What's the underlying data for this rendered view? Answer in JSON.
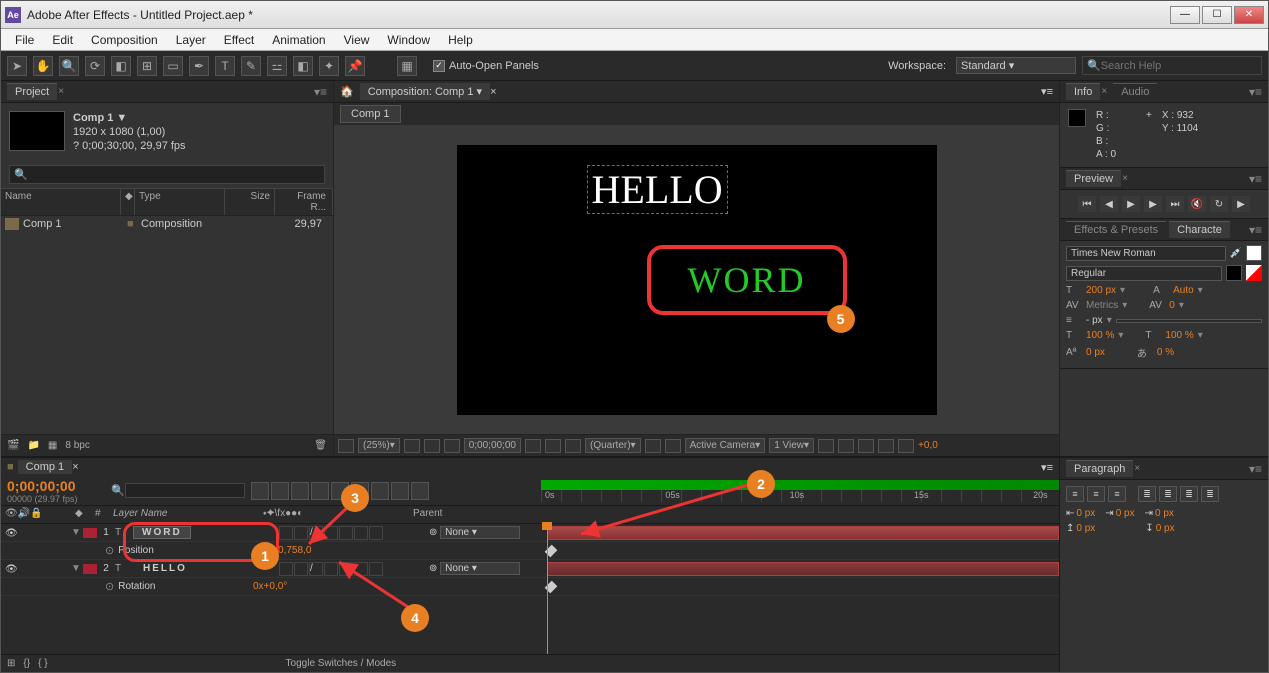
{
  "window": {
    "title": "Adobe After Effects - Untitled Project.aep *"
  },
  "menu": [
    "File",
    "Edit",
    "Composition",
    "Layer",
    "Effect",
    "Animation",
    "View",
    "Window",
    "Help"
  ],
  "toolbar": {
    "auto_open": "Auto-Open Panels",
    "workspace_label": "Workspace:",
    "workspace": "Standard",
    "search_placeholder": "Search Help"
  },
  "project": {
    "panel": "Project",
    "comp_name": "Comp 1 ▼",
    "comp_dims": "1920 x 1080 (1,00)",
    "comp_dur": "? 0;00;30;00, 29,97 fps",
    "cols": {
      "name": "Name",
      "type": "Type",
      "size": "Size",
      "frame": "Frame R..."
    },
    "rows": [
      {
        "name": "Comp 1",
        "type": "Composition",
        "size": "",
        "frame": "29,97"
      }
    ],
    "bpc": "8 bpc"
  },
  "comp_panel": {
    "title": "Composition: Comp 1",
    "tab": "Comp 1",
    "text1": "HELLO",
    "text2": "WORD",
    "footer": {
      "zoom": "(25%)",
      "time": "0;00;00;00",
      "quality": "(Quarter)",
      "camera": "Active Camera",
      "view": "1 View"
    }
  },
  "info": {
    "tab1": "Info",
    "tab2": "Audio",
    "r": "R :",
    "g": "G :",
    "b": "B :",
    "a": "A : 0",
    "x": "X : 932",
    "y": "Y : 1104"
  },
  "preview": {
    "tab": "Preview"
  },
  "effects": {
    "tab1": "Effects & Presets",
    "tab2": "Characte"
  },
  "char": {
    "font": "Times New Roman",
    "style": "Regular",
    "size": "200",
    "size_unit": "px",
    "leading": "Auto",
    "kerning": "Metrics",
    "tracking": "0",
    "stroke": "-",
    "stroke_unit": "px",
    "vscale": "100",
    "hscale": "100",
    "scale_unit": "%",
    "baseline": "0",
    "tsume": "0",
    "baseline_unit": "px",
    "tsume_unit": "%"
  },
  "timeline": {
    "tab": "Comp 1",
    "timecode": "0;00;00;00",
    "frames": "00000 (29.97 fps)",
    "ruler": [
      "0s",
      "05s",
      "10s",
      "15s",
      "20s"
    ],
    "col_layer": "Layer Name",
    "col_parent": "Parent",
    "layers": [
      {
        "num": "1",
        "name": "WORD",
        "parent": "None",
        "prop": "Position",
        "val": "1299,0,758,0"
      },
      {
        "num": "2",
        "name": "HELLO",
        "parent": "None",
        "prop": "Rotation",
        "val": "0x+0,0°"
      }
    ],
    "toggle": "Toggle Switches / Modes"
  },
  "paragraph": {
    "tab": "Paragraph",
    "indent_l": "0",
    "indent_fl": "0",
    "indent_r": "0",
    "space_b": "0",
    "space_a": "0",
    "unit": "px"
  },
  "annotations": {
    "a1": "1",
    "a2": "2",
    "a3": "3",
    "a4": "4",
    "a5": "5"
  }
}
